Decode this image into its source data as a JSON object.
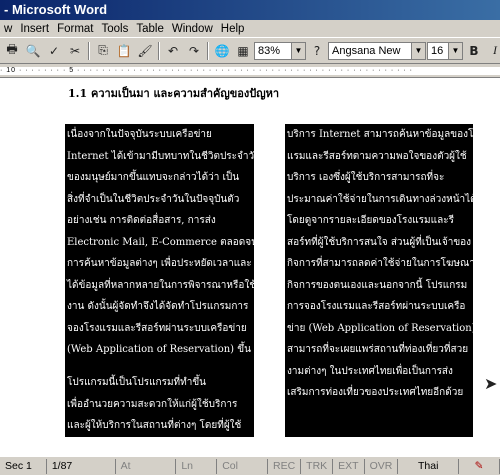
{
  "window": {
    "title": "- Microsoft Word"
  },
  "menu": [
    "w",
    "Insert",
    "Format",
    "Tools",
    "Table",
    "Window",
    "Help"
  ],
  "toolbar": {
    "zoom": "83%",
    "font": "Angsana New",
    "size": "16",
    "bold": "B",
    "italic": "I"
  },
  "document": {
    "heading": "1.1  ความเป็นมา  และความสำคัญของปัญหา",
    "column1": [
      "          เนื่องจากในปัจจุบันระบบเครือข่าย",
      "Internet ได้เข้ามามีบทบาทในชีวิตประจำวัน",
      "ของมนุษย์มากขึ้นแทบจะกล่าวได้ว่า เป็น",
      "สิ่งที่จำเป็นในชีวิตประจำวันในปัจจุบันตัว",
      "อย่างเช่น การติดต่อสื่อสาร, การส่ง",
      "Electronic Mail, E-Commerce ตลอดจนใน",
      "การค้นหาข้อมูลต่างๆ เพื่อประหยัดเวลาและ",
      "ได้ข้อมูลที่หลากหลายในการพิจารณาหรือใช้",
      "งาน ดังนั้นผู้จัดทำจึงได้จัดทำโปรแกรมการ",
      "จองโรงแรมและรีสอร์ทผ่านระบบเครือข่าย",
      "(Web Application of  Reservation) ขึ้น",
      "          โปรแกรมนี้เป็นโปรแกรมที่ทำขึ้น",
      "เพื่ออำนวยความสะดวกให้แก่ผู้ใช้บริการ",
      "และผู้ให้บริการในสถานที่ต่างๆ โดยที่ผู้ใช้"
    ],
    "column2": [
      "บริการ Internet สามารถค้นหาข้อมูลของโรง",
      "แรมและรีสอร์ทตามความพอใจของตัวผู้ใช้",
      "บริการ เองซึ่งผู้ใช้บริการสามารถที่จะ",
      "ประมาณค่าใช้จ่ายในการเดินทางล่วงหน้าได้",
      "โดยดูจากรายละเอียดของโรงแรมและรี",
      "สอร์ทที่ผู้ใช้บริการสนใจ ส่วนผู้ที่เป็นเจ้าของ",
      "กิจการที่สามารถลดค่าใช้จ่ายในการโฆษณา",
      "กิจการของตนเองและนอกจากนี้ โปรแกรม",
      "การจองโรงแรมและรีสอร์ทผ่านระบบเครือ",
      "ข่าย (Web Application of Reservation) ยัง",
      "สามารถที่จะเผยแพร่สถานที่ท่องเที่ยวที่สวย",
      "งามต่างๆ ในประเทศไทยเพื่อเป็นการส่ง",
      "เสริมการท่องเที่ยวของประเทศไทยอีกด้วย"
    ]
  },
  "status": {
    "sec": "Sec  1",
    "page": "1/87",
    "at": "At",
    "ln": "Ln",
    "col": "Col",
    "rec": "REC",
    "trk": "TRK",
    "ext": "EXT",
    "ovr": "OVR",
    "lang": "Thai"
  }
}
